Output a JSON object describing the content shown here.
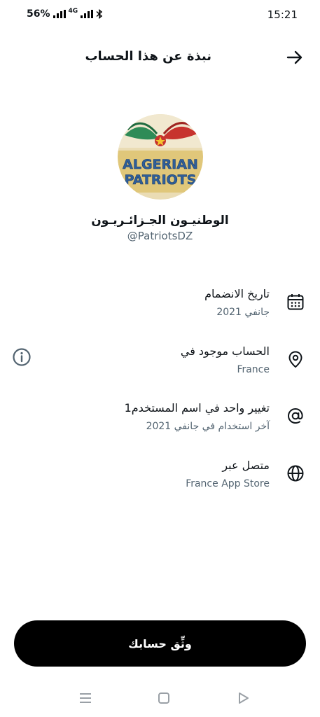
{
  "status_bar": {
    "battery": "56%",
    "network": "4G",
    "time": "15:21"
  },
  "header": {
    "title": "نبذة عن هذا الحساب",
    "back_icon": "arrow-right-icon"
  },
  "profile": {
    "avatar_lines": [
      "ALGERIAN",
      "PATRIOTS"
    ],
    "display_name": "الوطنيـون الجـزائـريـون",
    "handle": "@PatriotsDZ"
  },
  "info": {
    "joined": {
      "label": "تاريخ الانضمام",
      "value": "جانفي 2021",
      "icon": "calendar-icon"
    },
    "location": {
      "label": "الحساب موجود في",
      "value": "France",
      "icon": "location-pin-icon",
      "extra_icon": "info-icon"
    },
    "username_change": {
      "label": "تغيير واحد في اسم المستخدم1",
      "value": "آخر استخدام في جانفي 2021",
      "icon": "at-sign-icon"
    },
    "connected": {
      "label": "متصل عبر",
      "value": "France App Store",
      "icon": "globe-icon"
    }
  },
  "verify_button": {
    "label": "وثِّق حسابك"
  },
  "colors": {
    "text_primary": "#0f1419",
    "text_secondary": "#536471",
    "button_bg": "#000000",
    "background": "#ffffff"
  }
}
